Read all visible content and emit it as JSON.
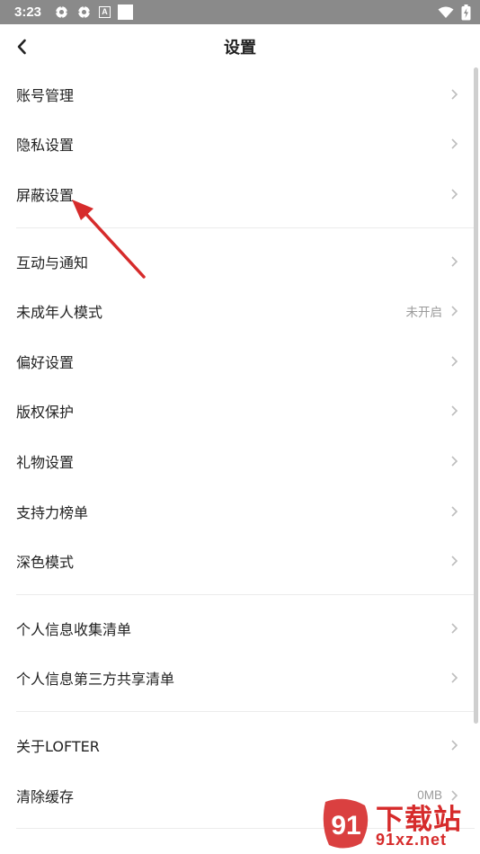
{
  "status_bar": {
    "time": "3:23",
    "badge_letter": "A",
    "icons": [
      "settings-gear-icon",
      "settings-gear-icon",
      "a-badge-icon",
      "square-icon",
      "wifi-icon",
      "battery-charging-icon"
    ]
  },
  "header": {
    "title": "设置",
    "back_icon": "chevron-left-icon"
  },
  "groups": [
    [
      {
        "label": "账号管理"
      },
      {
        "label": "隐私设置"
      },
      {
        "label": "屏蔽设置"
      }
    ],
    [
      {
        "label": "互动与通知"
      },
      {
        "label": "未成年人模式",
        "value": "未开启"
      },
      {
        "label": "偏好设置"
      },
      {
        "label": "版权保护"
      },
      {
        "label": "礼物设置"
      },
      {
        "label": "支持力榜单"
      },
      {
        "label": "深色模式"
      }
    ],
    [
      {
        "label": "个人信息收集清单"
      },
      {
        "label": "个人信息第三方共享清单"
      }
    ],
    [
      {
        "label": "关于LOFTER"
      },
      {
        "label": "清除缓存",
        "value": "0MB"
      }
    ]
  ],
  "watermark": {
    "line1": "下载站",
    "line2": "91xz.net",
    "logo_text": "91"
  },
  "colors": {
    "status_bar": "#8a8a8a",
    "annotation_arrow": "#d62b2b",
    "chevron": "#bdbdbd",
    "value_text": "#9a9a9a"
  }
}
